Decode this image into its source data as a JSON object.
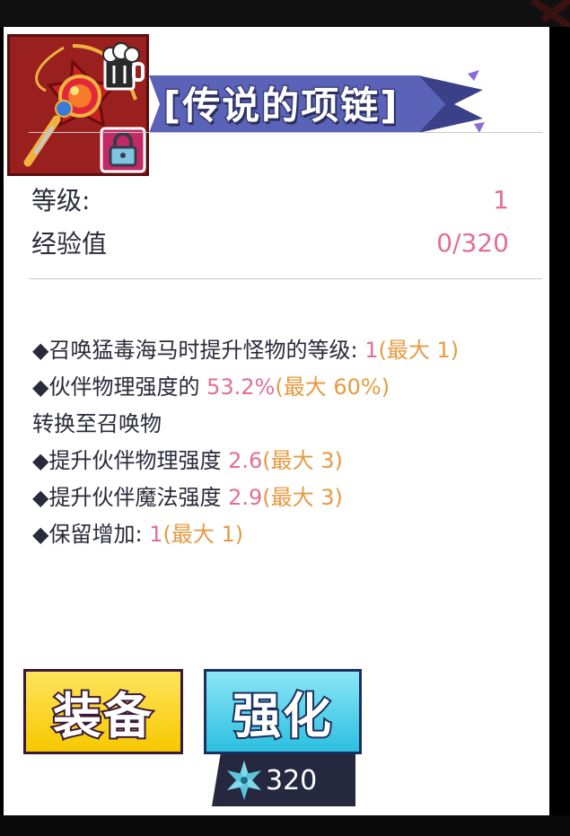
{
  "item": {
    "title": "[传说的项链]",
    "icon": "necklace-icon",
    "cup_icon": "cup-icon",
    "lock_icon": "lock-icon"
  },
  "stats": {
    "level_label": "等级:",
    "level_value": "1",
    "exp_label": "经验值",
    "exp_value": "0/320"
  },
  "effects": {
    "e1_text": "◆召唤猛毒海马时提升怪物的等级:",
    "e1_value": "1",
    "e1_max": "(最大 1)",
    "e2_text": "◆伙伴物理强度的",
    "e2_value": "53.2%",
    "e2_max": "(最大 60%)",
    "e2_tail": "转换至召唤物",
    "e3_text": "◆提升伙伴物理强度",
    "e3_value": "2.6",
    "e3_max": "(最大 3)",
    "e4_text": "◆提升伙伴魔法强度",
    "e4_value": "2.9",
    "e4_max": "(最大 3)",
    "e5_text": "◆保留增加:",
    "e5_value": "1",
    "e5_max": "(最大 1)"
  },
  "buttons": {
    "equip_label": "装备",
    "enhance_label": "强化",
    "enhance_cost": "320",
    "cost_icon": "crystal-icon"
  },
  "colors": {
    "value_pink": "#e26e96",
    "max_orange": "#e69a42",
    "equip_yellow": "#f6c800",
    "enhance_cyan": "#2cbfe0"
  }
}
